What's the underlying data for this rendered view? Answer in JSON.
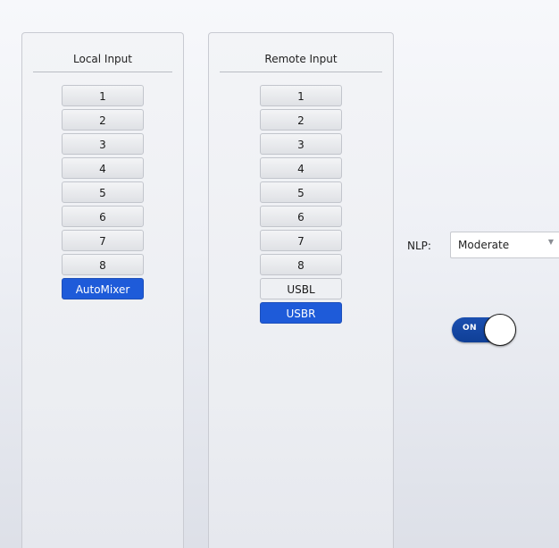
{
  "local_input": {
    "title": "Local Input",
    "buttons": [
      {
        "label": "1",
        "active": false
      },
      {
        "label": "2",
        "active": false
      },
      {
        "label": "3",
        "active": false
      },
      {
        "label": "4",
        "active": false
      },
      {
        "label": "5",
        "active": false
      },
      {
        "label": "6",
        "active": false
      },
      {
        "label": "7",
        "active": false
      },
      {
        "label": "8",
        "active": false
      },
      {
        "label": "AutoMixer",
        "active": true
      }
    ]
  },
  "remote_input": {
    "title": "Remote Input",
    "buttons": [
      {
        "label": "1",
        "active": false
      },
      {
        "label": "2",
        "active": false
      },
      {
        "label": "3",
        "active": false
      },
      {
        "label": "4",
        "active": false
      },
      {
        "label": "5",
        "active": false
      },
      {
        "label": "6",
        "active": false
      },
      {
        "label": "7",
        "active": false
      },
      {
        "label": "8",
        "active": false
      },
      {
        "label": "USBL",
        "active": false
      },
      {
        "label": "USBR",
        "active": true
      }
    ]
  },
  "nlp": {
    "label": "NLP:",
    "selected": "Moderate",
    "arrow_icon": "chevron-down-icon"
  },
  "toggle": {
    "state": "ON",
    "on": true
  },
  "colors": {
    "active": "#1e5bd9",
    "toggle_on": "#1b4fb0"
  }
}
